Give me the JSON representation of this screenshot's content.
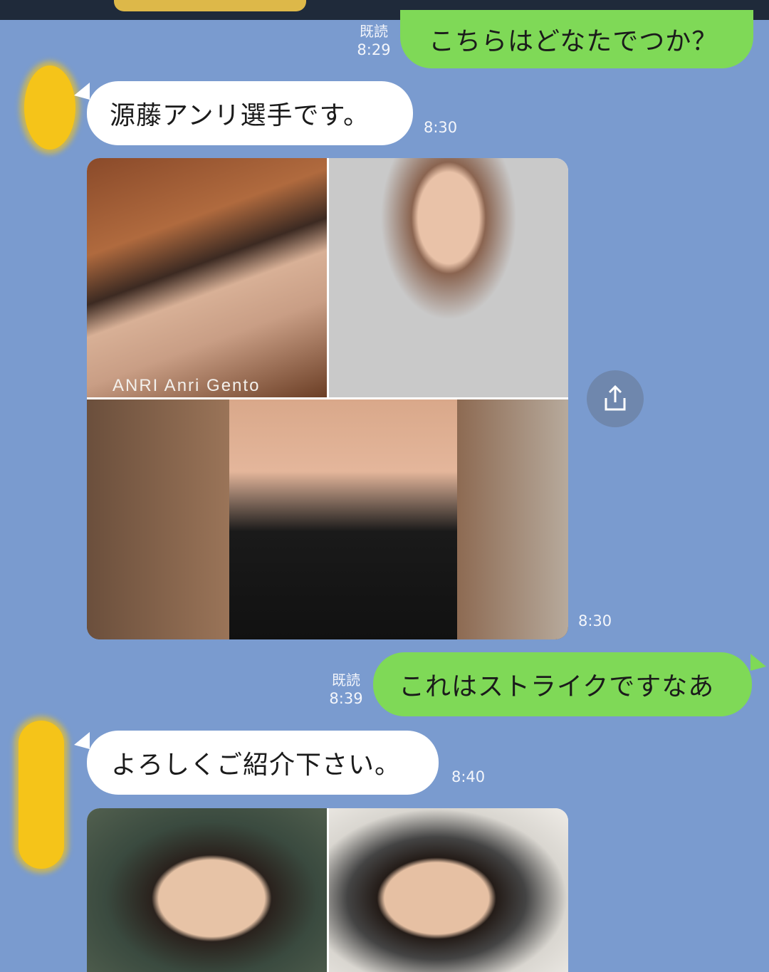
{
  "colors": {
    "background": "#7a9bcf",
    "outgoing_bubble": "#7fd957",
    "incoming_bubble": "#ffffff",
    "top_bar": "#1f2a3a"
  },
  "messages": [
    {
      "direction": "out",
      "text": "こちらはどなたでつか？",
      "read_label": "既読",
      "time": "8:29"
    },
    {
      "direction": "in",
      "text": "源藤アンリ選手です。",
      "time": "8:30"
    },
    {
      "direction": "in",
      "type": "image_collage",
      "caption": "ANRI Anri Gento",
      "time": "8:30",
      "action_icon": "share-icon"
    },
    {
      "direction": "out",
      "text": "これはストライクですなあ",
      "read_label": "既読",
      "time": "8:39"
    },
    {
      "direction": "in",
      "text": "よろしくご紹介下さい。",
      "time": "8:40"
    },
    {
      "direction": "in",
      "type": "image_collage"
    }
  ]
}
